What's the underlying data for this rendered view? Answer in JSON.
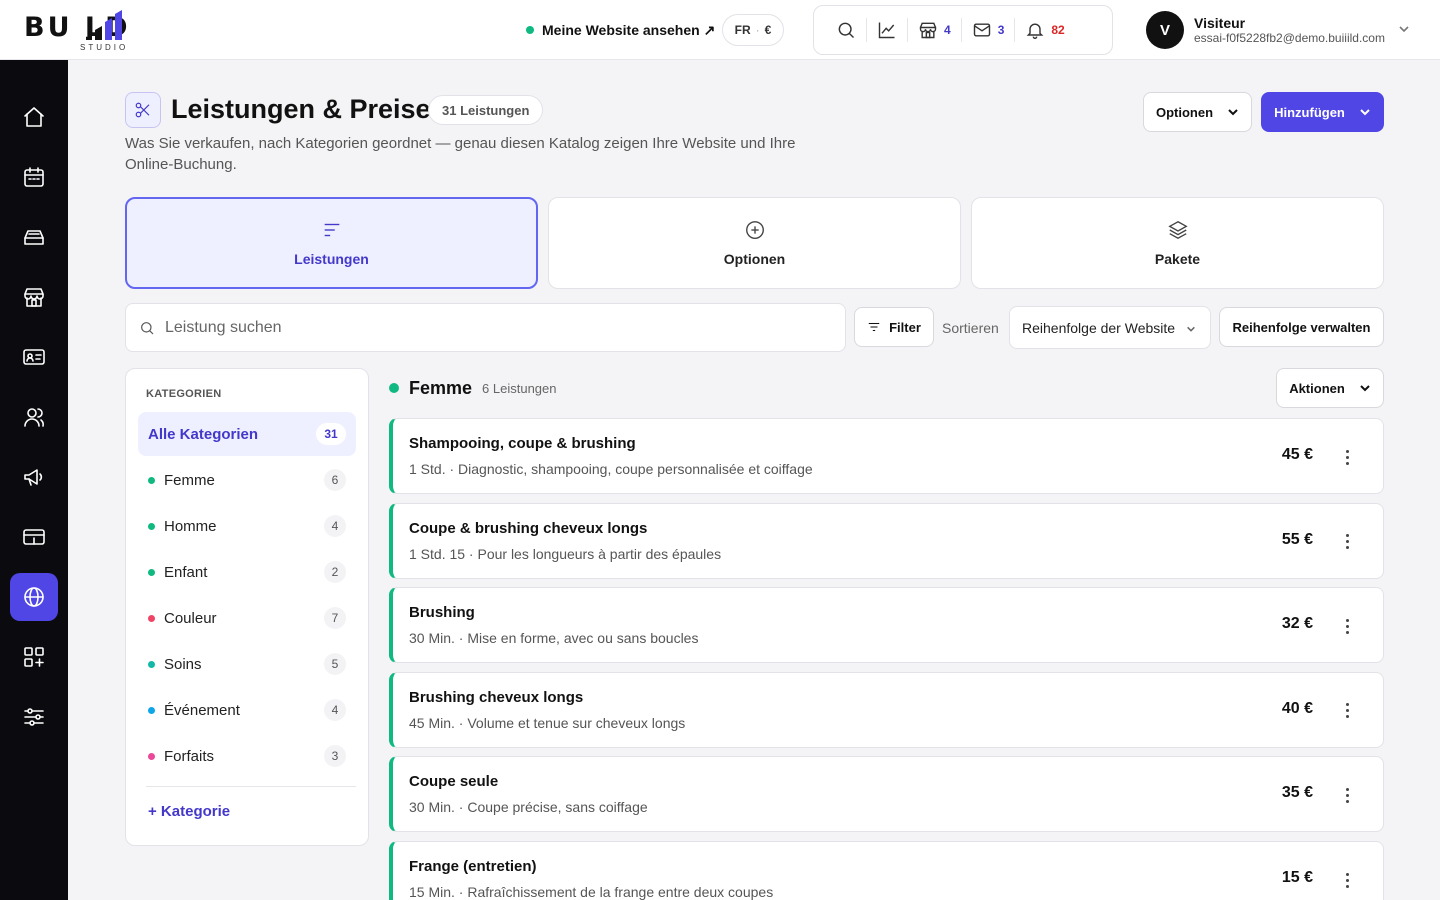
{
  "brand": {
    "name": "BU  LD",
    "sub": "STUDIO"
  },
  "topbar": {
    "site_link": "Meine Website ansehen ↗",
    "lang": "FR",
    "currency": "€",
    "icons": [
      {
        "icon": "search-icon"
      },
      {
        "icon": "chart-icon"
      },
      {
        "icon": "store-icon",
        "count": "4"
      },
      {
        "icon": "mail-icon",
        "count": "3"
      },
      {
        "icon": "bell-icon",
        "count": "82"
      }
    ],
    "user": {
      "initial": "V",
      "name": "Visiteur",
      "email": "essai-f0f5228fb2@demo.buiiild.com"
    }
  },
  "header": {
    "title": "Leistungen & Preise",
    "count": "31 Leistungen",
    "subtitle": "Was Sie verkaufen, nach Kategorien geordnet — genau diesen Katalog zeigen Ihre Website und Ihre Online-Buchung.",
    "options_label": "Optionen",
    "add_label": "Hinzufügen"
  },
  "tabs": [
    {
      "label": "Leistungen",
      "active": true
    },
    {
      "label": "Optionen",
      "active": false
    },
    {
      "label": "Pakete",
      "active": false
    }
  ],
  "toolbar": {
    "search_placeholder": "Leistung suchen",
    "filter_label": "Filter",
    "sort_label": "Sortieren",
    "sort_value": "Reihenfolge der Website",
    "manage_order_label": "Reihenfolge verwalten"
  },
  "categories": {
    "heading": "KATEGORIEN",
    "all": {
      "name": "Alle Kategorien",
      "count": "31"
    },
    "items": [
      {
        "name": "Femme",
        "count": "6",
        "color": "#10b981"
      },
      {
        "name": "Homme",
        "count": "4",
        "color": "#10b981"
      },
      {
        "name": "Enfant",
        "count": "2",
        "color": "#10b981"
      },
      {
        "name": "Couleur",
        "count": "7",
        "color": "#ef4466"
      },
      {
        "name": "Soins",
        "count": "5",
        "color": "#14b8a6"
      },
      {
        "name": "Événement",
        "count": "4",
        "color": "#0ea5e9"
      },
      {
        "name": "Forfaits",
        "count": "3",
        "color": "#ec4899"
      }
    ],
    "add_label": "+ Kategorie"
  },
  "section": {
    "name": "Femme",
    "count": "6 Leistungen",
    "color": "#10b981",
    "actions_label": "Aktionen",
    "services": [
      {
        "name": "Shampooing, coupe & brushing",
        "desc": "1 Std. · Diagnostic, shampooing, coupe personnalisée et coiffage",
        "price": "45 €"
      },
      {
        "name": "Coupe & brushing cheveux longs",
        "desc": "1 Std. 15 · Pour les longueurs à partir des épaules",
        "price": "55 €"
      },
      {
        "name": "Brushing",
        "desc": "30 Min. · Mise en forme, avec ou sans boucles",
        "price": "32 €"
      },
      {
        "name": "Brushing cheveux longs",
        "desc": "45 Min. · Volume et tenue sur cheveux longs",
        "price": "40 €"
      },
      {
        "name": "Coupe seule",
        "desc": "30 Min. · Coupe précise, sans coiffage",
        "price": "35 €"
      },
      {
        "name": "Frange (entretien)",
        "desc": "15 Min. · Rafraîchissement de la frange entre deux coupes",
        "price": "15 €"
      }
    ]
  },
  "sidebar": {
    "items": [
      {
        "icon": "home-icon"
      },
      {
        "icon": "calendar-icon"
      },
      {
        "icon": "inbox-icon"
      },
      {
        "icon": "store-icon"
      },
      {
        "icon": "contact-card-icon"
      },
      {
        "icon": "users-icon"
      },
      {
        "icon": "megaphone-icon"
      },
      {
        "icon": "register-icon"
      },
      {
        "icon": "globe-icon",
        "active": true
      },
      {
        "icon": "apps-icon"
      },
      {
        "icon": "sliders-icon"
      }
    ]
  }
}
